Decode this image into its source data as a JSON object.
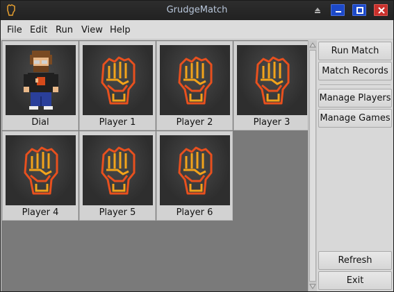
{
  "window": {
    "title": "GrudgeMatch"
  },
  "menu": [
    "File",
    "Edit",
    "Run",
    "View",
    "Help"
  ],
  "players": [
    {
      "name": "Dial",
      "avatar": "pixel-person"
    },
    {
      "name": "Player 1",
      "avatar": "fist-icon"
    },
    {
      "name": "Player 2",
      "avatar": "fist-icon"
    },
    {
      "name": "Player 3",
      "avatar": "fist-icon"
    },
    {
      "name": "Player 4",
      "avatar": "fist-icon"
    },
    {
      "name": "Player 5",
      "avatar": "fist-icon"
    },
    {
      "name": "Player 6",
      "avatar": "fist-icon"
    }
  ],
  "actions": {
    "run_match": "Run Match",
    "match_records": "Match Records",
    "manage_players": "Manage Players",
    "manage_games": "Manage Games",
    "refresh": "Refresh",
    "exit": "Exit"
  },
  "colors": {
    "titlebar": "#222222",
    "title_text": "#b8c6da",
    "window_btn_blue": "#1c49c9",
    "close_red": "#c9302c",
    "fist_outer": "#e8501e",
    "fist_inner": "#f2a31b",
    "grid_bg": "#7a7a7a"
  }
}
